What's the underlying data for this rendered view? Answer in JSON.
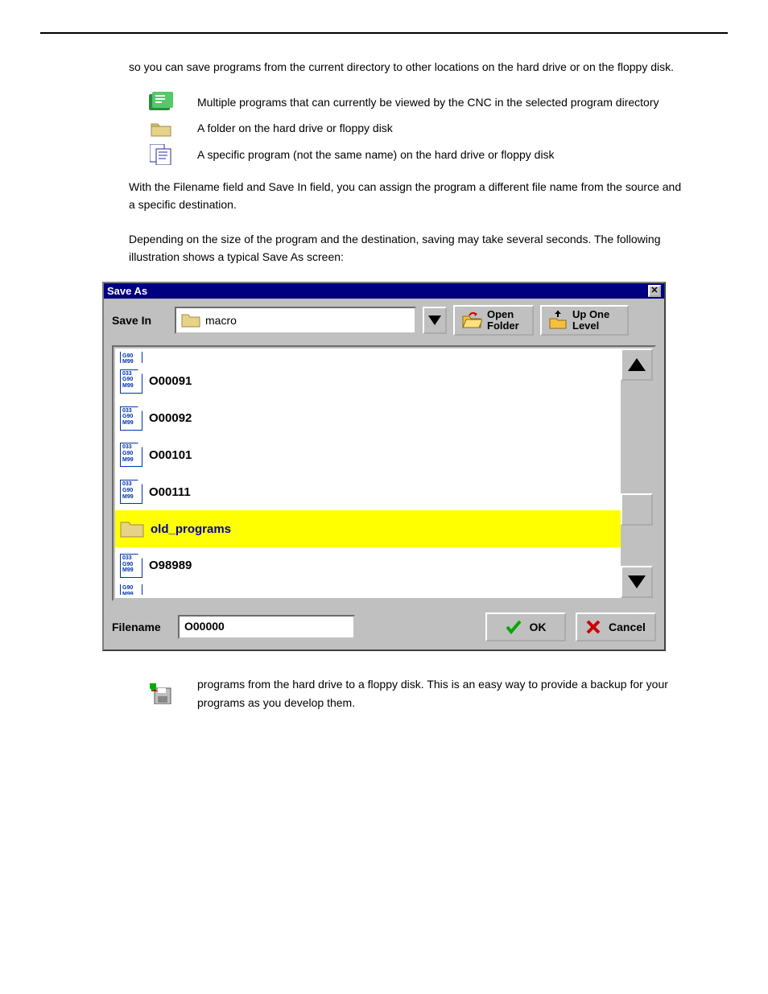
{
  "intro_text": "so you can save programs from the current directory to other locations on the hard drive or on the floppy disk.",
  "icon_rows": [
    {
      "icon": "multi-program",
      "text": "Multiple programs that can currently be viewed by the CNC in the selected program directory"
    },
    {
      "icon": "folder",
      "text": "A folder on the hard drive or floppy disk"
    },
    {
      "icon": "program-file",
      "text": "A specific program (not the same name) on the hard drive or floppy disk"
    }
  ],
  "post_text_1": "With the Filename field and Save In field, you can assign the program a different file name from the source and a specific destination.",
  "post_text_2": "Depending on the size of the program and the destination, saving may take several seconds. The following illustration shows a typical Save As screen:",
  "dialog": {
    "title": "Save As",
    "savein_label": "Save In",
    "savein_value": "macro",
    "open_folder": "Open Folder",
    "up_one": "Up One Level",
    "files": [
      {
        "type": "prog-partial",
        "name": ""
      },
      {
        "type": "prog",
        "name": "O00091"
      },
      {
        "type": "prog",
        "name": "O00092"
      },
      {
        "type": "prog",
        "name": "O00101"
      },
      {
        "type": "prog",
        "name": "O00111"
      },
      {
        "type": "folder",
        "name": "old_programs",
        "selected": true
      },
      {
        "type": "prog",
        "name": "O98989"
      },
      {
        "type": "prog-partial",
        "name": ""
      }
    ],
    "filename_label": "Filename",
    "filename_value": "O00000",
    "ok": "OK",
    "cancel": "Cancel"
  },
  "floppy_row": {
    "text": "programs from the hard drive to a floppy disk. This is an easy way to provide a backup for your programs as you develop them."
  }
}
